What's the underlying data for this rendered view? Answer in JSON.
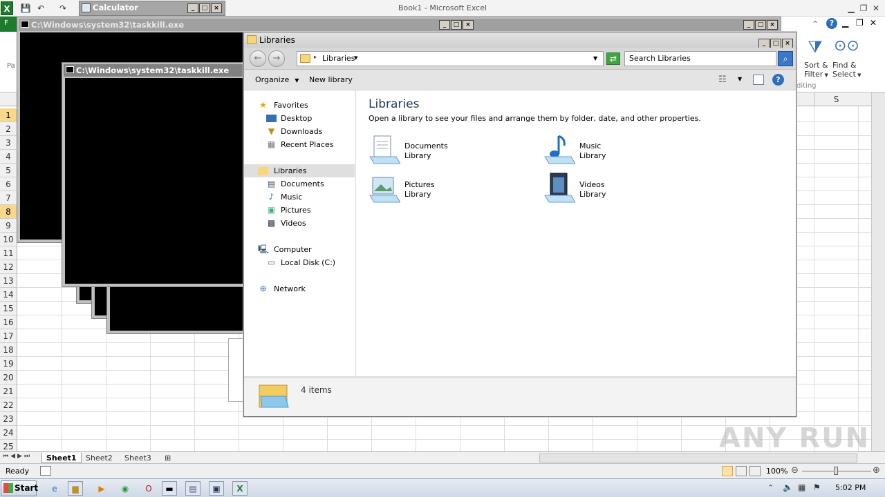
{
  "excel": {
    "title": "Book1  -  Microsoft Excel",
    "logo": "X",
    "file_tab": "F",
    "paste_label": "Pa",
    "ribbon": {
      "sort_filter_1": "Sort &",
      "sort_filter_2": "Filter",
      "find_select_1": "Find &",
      "find_select_2": "Select",
      "group_label": "diting"
    },
    "col_header_S": "S",
    "rows": [
      "1",
      "2",
      "3",
      "4",
      "5",
      "6",
      "7",
      "8",
      "9",
      "10",
      "11",
      "12",
      "13",
      "14",
      "15",
      "16",
      "17",
      "18",
      "19",
      "20",
      "21",
      "22",
      "23",
      "24",
      "25"
    ],
    "sheet_tabs": [
      "Sheet1",
      "Sheet2",
      "Sheet3"
    ],
    "status": "Ready",
    "zoom": "100%"
  },
  "calculator": {
    "title": "Calculator"
  },
  "cmd_windows": [
    {
      "title": "C:\\Windows\\system32\\taskkill.exe"
    },
    {
      "title": "C:\\Windows\\system32\\taskkill.exe"
    }
  ],
  "explorer": {
    "title": "Libraries",
    "breadcrumb": "Libraries",
    "search_placeholder": "Search Libraries",
    "toolbar": {
      "organize": "Organize",
      "new_library": "New library"
    },
    "nav": {
      "favorites": "Favorites",
      "desktop": "Desktop",
      "downloads": "Downloads",
      "recent": "Recent Places",
      "libraries": "Libraries",
      "documents": "Documents",
      "music": "Music",
      "pictures": "Pictures",
      "videos": "Videos",
      "computer": "Computer",
      "local_disk": "Local Disk (C:)",
      "network": "Network"
    },
    "heading": "Libraries",
    "subheading": "Open a library to see your files and arrange them by folder, date, and other properties.",
    "libraries": [
      {
        "name": "Documents",
        "type": "Library"
      },
      {
        "name": "Music",
        "type": "Library"
      },
      {
        "name": "Pictures",
        "type": "Library"
      },
      {
        "name": "Videos",
        "type": "Library"
      }
    ],
    "item_count": "4 items"
  },
  "taskbar": {
    "start": "Start",
    "time": "5:02 PM"
  },
  "watermark": "ANY RUN"
}
